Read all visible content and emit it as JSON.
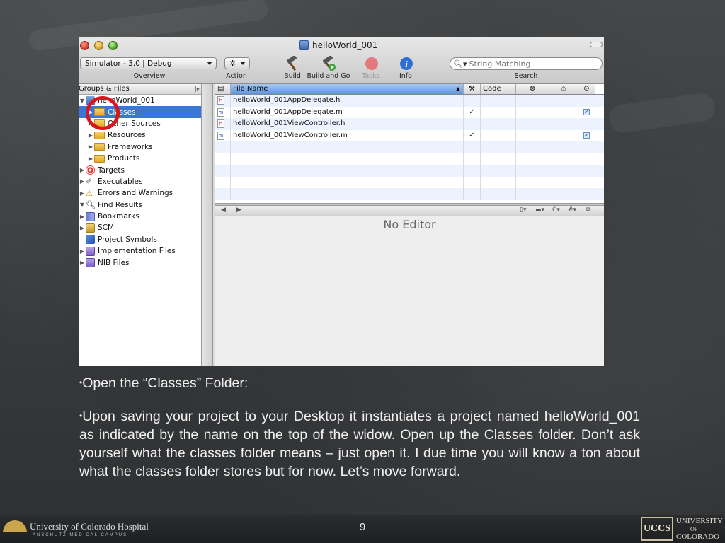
{
  "window": {
    "title": "helloWorld_001",
    "overview_value": "Simulator - 3.0 | Debug",
    "labels": {
      "overview": "Overview",
      "action": "Action",
      "build": "Build",
      "build_and_go": "Build and Go",
      "tasks": "Tasks",
      "info": "Info",
      "search": "Search"
    },
    "search_placeholder": "String Matching"
  },
  "sidebar": {
    "header": "Groups & Files",
    "items": [
      {
        "label": "helloWorld_001",
        "icon": "project-icon"
      },
      {
        "label": "Classes",
        "icon": "folder-icon"
      },
      {
        "label": "Other Sources",
        "icon": "folder-icon"
      },
      {
        "label": "Resources",
        "icon": "folder-icon"
      },
      {
        "label": "Frameworks",
        "icon": "folder-icon"
      },
      {
        "label": "Products",
        "icon": "folder-icon"
      },
      {
        "label": "Targets",
        "icon": "target-icon"
      },
      {
        "label": "Executables",
        "icon": "executable-icon"
      },
      {
        "label": "Errors and Warnings",
        "icon": "warning-icon"
      },
      {
        "label": "Find Results",
        "icon": "magnifier-icon"
      },
      {
        "label": "Bookmarks",
        "icon": "bookmark-icon"
      },
      {
        "label": "SCM",
        "icon": "scm-icon"
      },
      {
        "label": "Project Symbols",
        "icon": "cube-icon"
      },
      {
        "label": "Implementation Files",
        "icon": "smart-group-icon"
      },
      {
        "label": "NIB Files",
        "icon": "smart-group-icon"
      }
    ]
  },
  "file_table": {
    "columns": {
      "name": "File Name",
      "code": "Code"
    },
    "rows": [
      {
        "name": "helloWorld_001AppDelegate.h",
        "type": "h",
        "built": "",
        "target": ""
      },
      {
        "name": "helloWorld_001AppDelegate.m",
        "type": "m",
        "built": "✓",
        "target": "✓"
      },
      {
        "name": "helloWorld_001ViewController.h",
        "type": "h",
        "built": "",
        "target": ""
      },
      {
        "name": "helloWorld_001ViewController.m",
        "type": "m",
        "built": "✓",
        "target": "✓"
      }
    ]
  },
  "editor": {
    "empty_text": "No Editor"
  },
  "slide": {
    "bullet1": "Open the “Classes” Folder:",
    "bullet2": "Upon saving your project to your Desktop it instantiates a project named helloWorld_001 as indicated by the name on the top of the widow.  Open up the Classes folder. Don’t ask yourself what the classes folder means – just open it.  I due time you will know a ton about what the classes folder stores but for now.  Let’s move forward.",
    "page_number": "9",
    "logo_left": "University of Colorado Hospital",
    "logo_left_sub": "ANSCHUTZ MEDICAL CAMPUS",
    "logo_right_box": "UCCS",
    "logo_right_line1": "UNIVERSITY",
    "logo_right_line2": "OF",
    "logo_right_line3": "COLORADO"
  },
  "colors": {
    "selection": "#3877d5",
    "highlight_circle": "#d6171f",
    "chalkboard": "#3c3f41"
  }
}
